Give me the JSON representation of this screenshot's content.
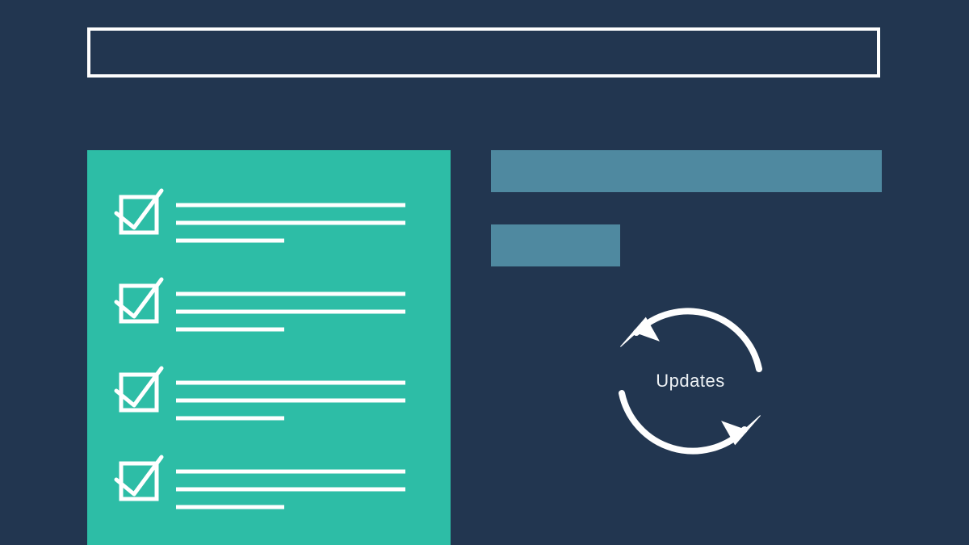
{
  "title_bar": {
    "text": ""
  },
  "right_bars": {
    "large": "",
    "small": ""
  },
  "checklist": {
    "items": [
      {
        "checked": true
      },
      {
        "checked": true
      },
      {
        "checked": true
      },
      {
        "checked": true
      }
    ]
  },
  "cycle": {
    "label": "Updates"
  },
  "colors": {
    "background": "#223650",
    "panel": "#2dbda6",
    "bar": "#4f89a0",
    "stroke": "#fefefe"
  }
}
